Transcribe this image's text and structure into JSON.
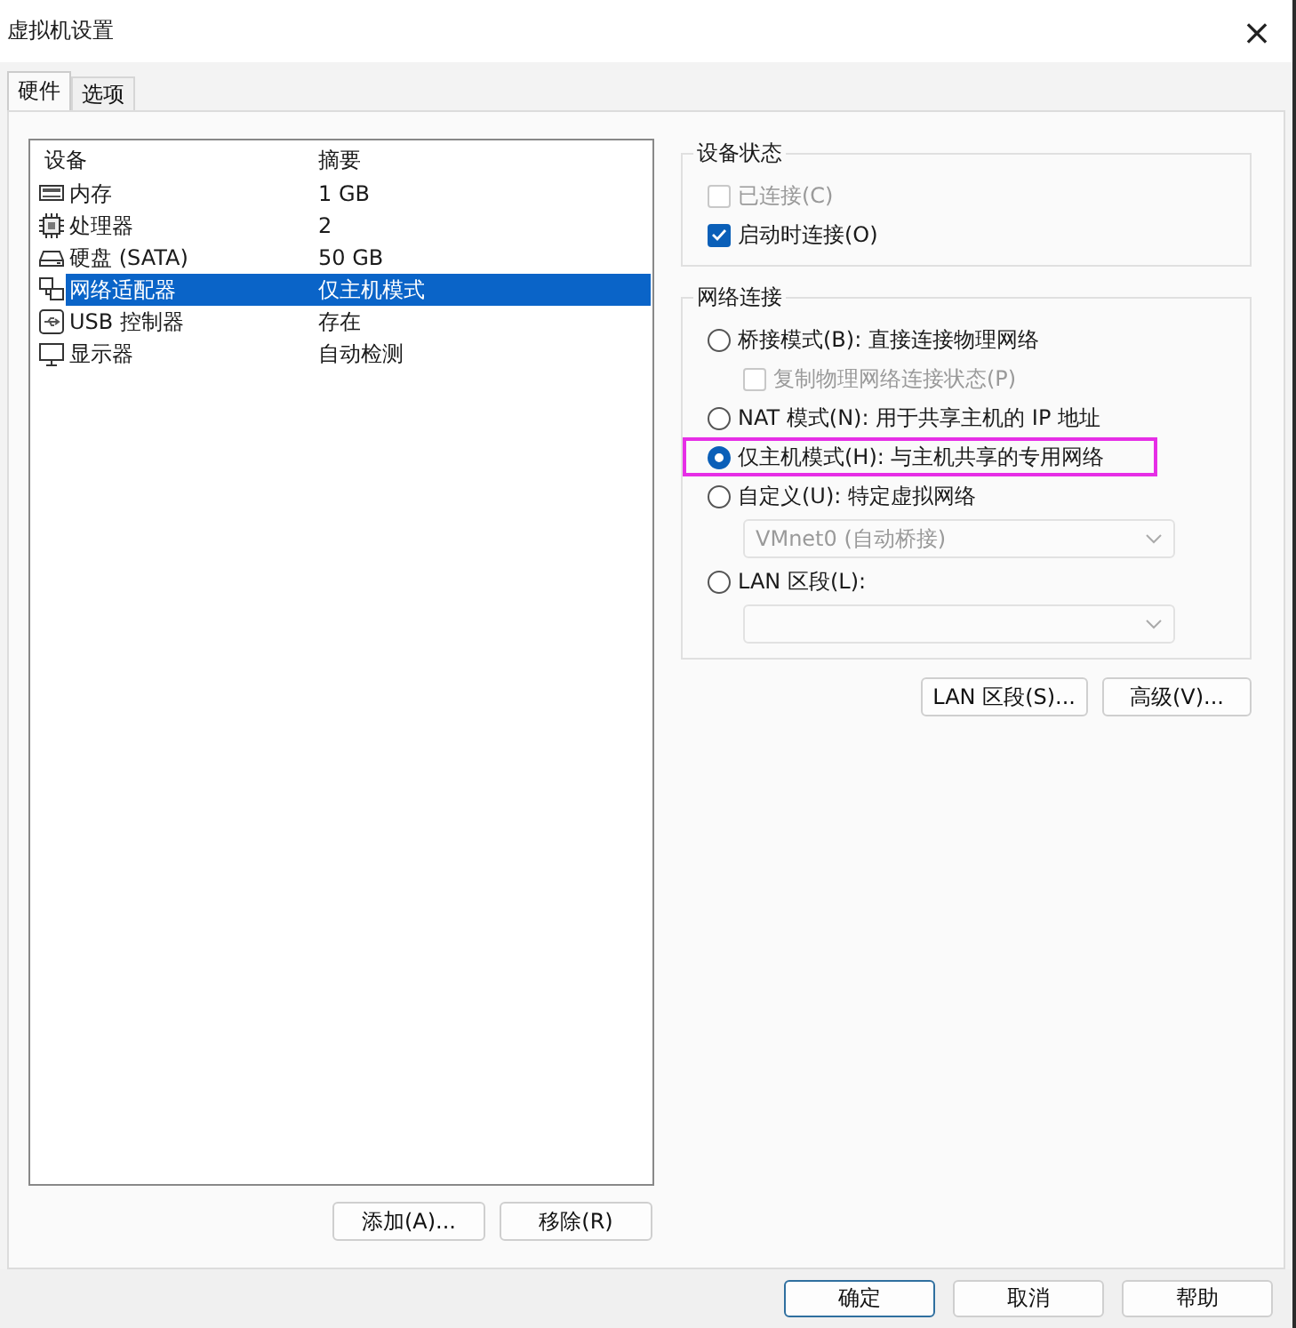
{
  "window": {
    "title": "虚拟机设置",
    "close": "×"
  },
  "tabs": [
    {
      "label": "硬件",
      "selected": true
    },
    {
      "label": "选项",
      "selected": false
    }
  ],
  "devices": {
    "columns": [
      "设备",
      "摘要"
    ],
    "rows": [
      {
        "kind": "memory",
        "device": "内存",
        "summary": "1 GB",
        "selected": false
      },
      {
        "kind": "cpu",
        "device": "处理器",
        "summary": "2",
        "selected": false
      },
      {
        "kind": "disk",
        "device": "硬盘 (SATA)",
        "summary": "50 GB",
        "selected": false
      },
      {
        "kind": "network",
        "device": "网络适配器",
        "summary": "仅主机模式",
        "selected": true
      },
      {
        "kind": "usb",
        "device": "USB 控制器",
        "summary": "存在",
        "selected": false
      },
      {
        "kind": "display",
        "device": "显示器",
        "summary": "自动检测",
        "selected": false
      }
    ]
  },
  "device_buttons": [
    "添加(A)...",
    "移除(R)"
  ],
  "device_status": {
    "title": "设备状态",
    "options": [
      {
        "label": "已连接(C)",
        "checked": false,
        "disabled": true
      },
      {
        "label": "启动时连接(O)",
        "checked": true,
        "disabled": false
      }
    ]
  },
  "network": {
    "title": "网络连接",
    "items": [
      {
        "kind": "radio",
        "label": "桥接模式(B): 直接连接物理网络",
        "selected": false,
        "highlighted": false
      },
      {
        "kind": "checkbox",
        "label": "复制物理网络连接状态(P)",
        "checked": false,
        "disabled": true
      },
      {
        "kind": "radio",
        "label": "NAT 模式(N): 用于共享主机的 IP 地址",
        "selected": false,
        "highlighted": false
      },
      {
        "kind": "radio",
        "label": "仅主机模式(H): 与主机共享的专用网络",
        "selected": true,
        "highlighted": true
      },
      {
        "kind": "radio",
        "label": "自定义(U): 特定虚拟网络",
        "selected": false,
        "highlighted": false
      },
      {
        "kind": "dropdown",
        "value": "VMnet0 (自动桥接)",
        "disabled": true
      },
      {
        "kind": "radio",
        "label": "LAN 区段(L):",
        "selected": false,
        "highlighted": false
      },
      {
        "kind": "dropdown",
        "disabled": true
      }
    ]
  },
  "network_buttons": [
    "LAN 区段(S)...",
    "高级(V)..."
  ],
  "dialog_buttons": [
    {
      "label": "确定",
      "default": true
    },
    {
      "label": "取消",
      "default": false
    },
    {
      "label": "帮助",
      "default": false
    }
  ]
}
